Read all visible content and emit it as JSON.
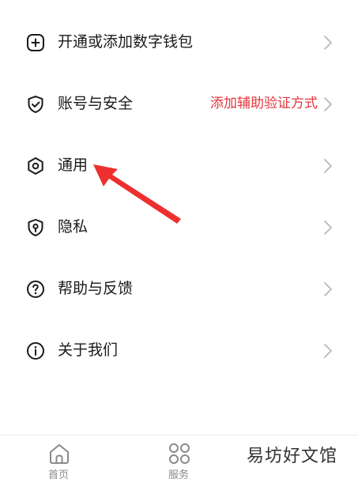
{
  "menu": {
    "items": [
      {
        "label": "开通或添加数字钱包",
        "icon": "plus-circle-icon",
        "hint": ""
      },
      {
        "label": "账号与安全",
        "icon": "shield-check-icon",
        "hint": "添加辅助验证方式"
      },
      {
        "label": "通用",
        "icon": "hexagon-settings-icon",
        "hint": ""
      },
      {
        "label": "隐私",
        "icon": "privacy-shield-icon",
        "hint": ""
      },
      {
        "label": "帮助与反馈",
        "icon": "help-circle-icon",
        "hint": ""
      },
      {
        "label": "关于我们",
        "icon": "info-circle-icon",
        "hint": ""
      }
    ]
  },
  "tabbar": {
    "tabs": [
      {
        "label": "首页",
        "icon": "home-icon"
      },
      {
        "label": "服务",
        "icon": "grid-icon"
      }
    ]
  },
  "watermark": {
    "text": "易坊好文馆"
  },
  "colors": {
    "hint": "#e5373d",
    "arrow": "#ee2f2f",
    "text": "#1a1a1a",
    "tab_text": "#8a8a8a"
  }
}
